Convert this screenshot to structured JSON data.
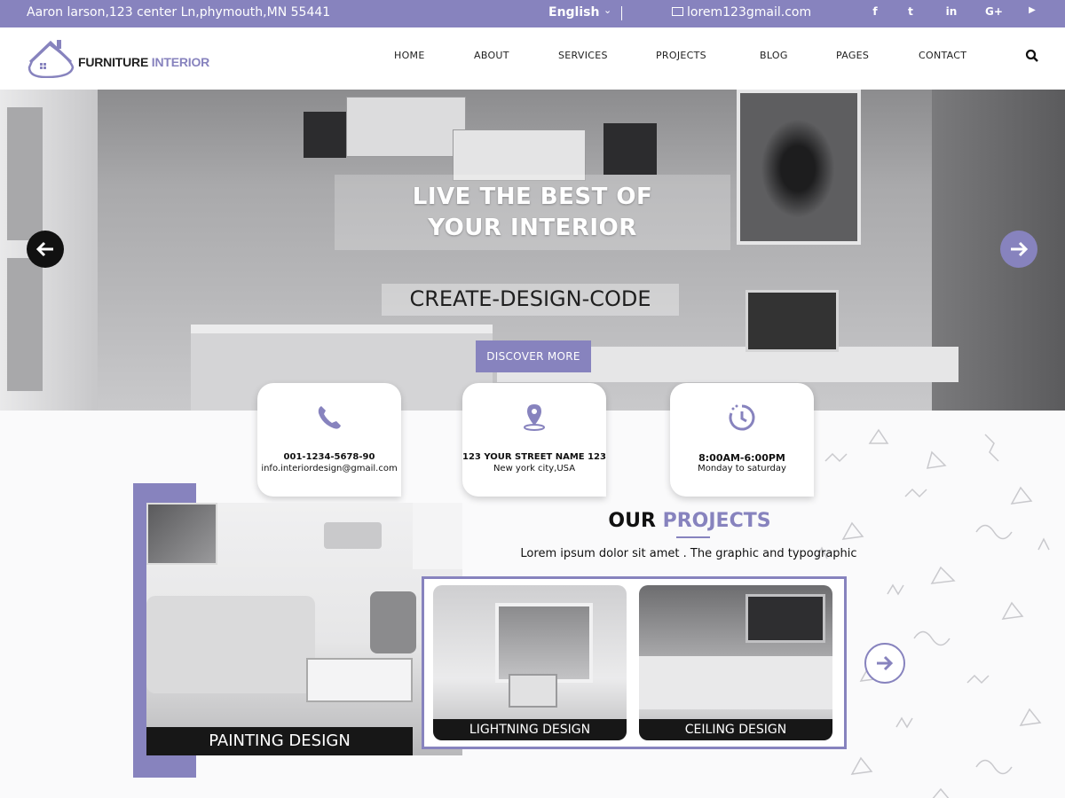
{
  "topbar": {
    "address": "Aaron larson,123 center Ln,phymouth,MN 55441",
    "language": "English",
    "email": "lorem123gmail.com",
    "social": [
      {
        "name": "facebook-icon",
        "glyph": "f"
      },
      {
        "name": "twitter-icon",
        "glyph": "t"
      },
      {
        "name": "linkedin-icon",
        "glyph": "in"
      },
      {
        "name": "google-plus-icon",
        "glyph": "G+"
      },
      {
        "name": "youtube-icon",
        "glyph": "▶"
      }
    ]
  },
  "header": {
    "logo_part1": "FURNITURE",
    "logo_part2": "INTERIOR",
    "nav": [
      "HOME",
      "ABOUT",
      "SERVICES",
      "PROJECTS",
      "BLOG",
      "PAGES",
      "CONTACT"
    ]
  },
  "hero": {
    "title_line1": "LIVE THE BEST OF",
    "title_line2": "YOUR INTERIOR",
    "subtitle": "CREATE-DESIGN-CODE",
    "button": "DISCOVER MORE"
  },
  "info_cards": [
    {
      "icon": "phone-icon",
      "line1": "001-1234-5678-90",
      "line2": "info.interiordesign@gmail.com"
    },
    {
      "icon": "location-pin-icon",
      "line1": "123 YOUR STREET NAME 123",
      "line2": "New york city,USA"
    },
    {
      "icon": "clock-icon",
      "line1": "8:00AM-6:00PM",
      "line2": "Monday to saturday"
    }
  ],
  "projects": {
    "title_part1": "OUR",
    "title_part2": "PROJECTS",
    "description": "Lorem ipsum dolor sit amet . The graphic and typographic",
    "featured_label": "PAINTING DESIGN",
    "items": [
      "LIGHTNING DESIGN",
      "CEILING DESIGN"
    ]
  },
  "colors": {
    "accent": "#8783be",
    "dark": "#171717",
    "topbar_text": "#ffffff"
  }
}
